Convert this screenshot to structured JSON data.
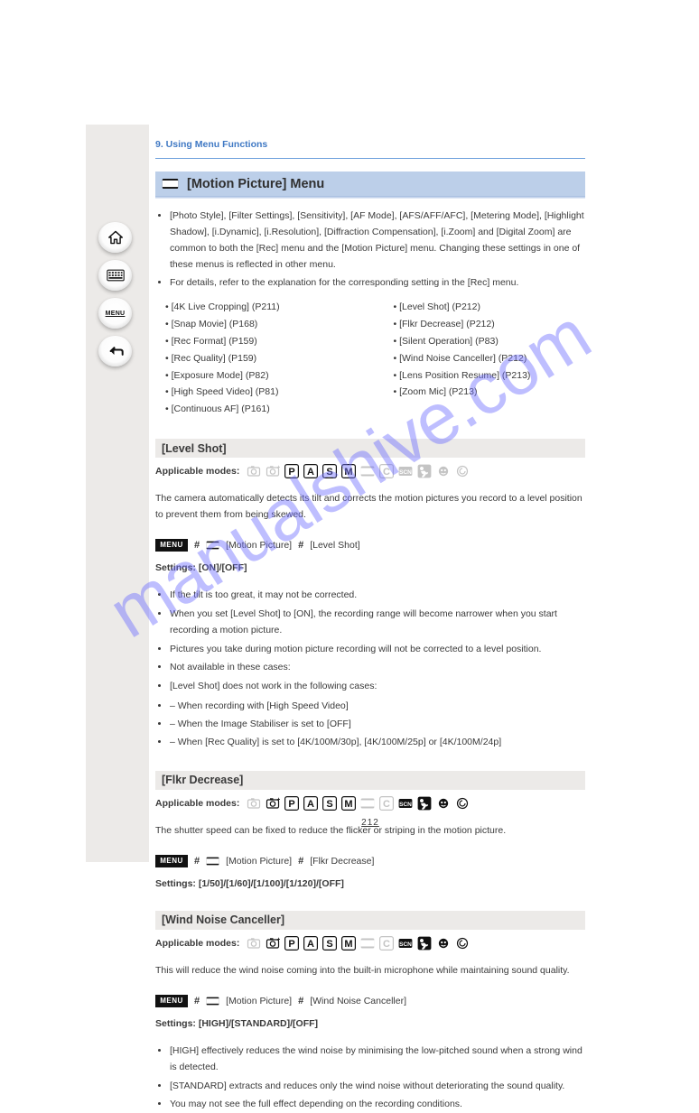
{
  "page": {
    "crumb": "9. Using Menu Functions",
    "title": "[Motion Picture] Menu",
    "page_number": "212"
  },
  "nav": {
    "menu_label": "MENU"
  },
  "intro": {
    "paragraphs": [
      "[Photo Style], [Filter Settings], [Sensitivity], [AF Mode], [AFS/AFF/AFC], [Metering Mode], [Highlight Shadow], [i.Dynamic], [i.Resolution], [Diffraction Compensation], [i.Zoom] and [Digital Zoom] are common to both the [Rec] menu and the [Motion Picture] menu. Changing these settings in one of these menus is reflected in other menu.",
      "For details, refer to the explanation for the corresponding setting in the [Rec] menu."
    ],
    "links": [
      "[4K Live Cropping] (P211)",
      "[Snap Movie] (P168)",
      "[Rec Format] (P159)",
      "[Rec Quality] (P159)",
      "[Exposure Mode] (P82)",
      "[High Speed Video] (P81)",
      "[Continuous AF] (P161)",
      "[Level Shot] (P212)",
      "[Flkr Decrease] (P212)",
      "[Silent Operation] (P83)",
      "[Wind Noise Canceller] (P212)",
      "[Lens Position Resume] (P213)",
      "[Zoom Mic] (P213)"
    ]
  },
  "menu_chip": "MENU",
  "arrow": "#",
  "sections": [
    {
      "title": "[Level Shot]",
      "modes_label": "Applicable modes:",
      "modes": [
        "ia",
        "iaplus",
        "P",
        "A",
        "S",
        "M",
        "mov",
        "c",
        "scn",
        "run",
        "face",
        "cc"
      ],
      "modes_dim": [
        "ia",
        "iaplus",
        "mov",
        "c",
        "scn",
        "run",
        "face",
        "cc"
      ],
      "body": "The camera automatically detects its tilt and corrects the motion pictures you record to a level position to prevent them from being skewed.",
      "menu_path": [
        "[Motion Picture]",
        "[Level Shot]"
      ],
      "settings": "Settings: [ON]/[OFF]",
      "bullets": [
        "If the tilt is too great, it may not be corrected.",
        "When you set [Level Shot] to [ON], the recording range will become narrower when you start recording a motion picture.",
        "Pictures you take during motion picture recording will not be corrected to a level position.",
        "Not available in these cases:",
        "[Level Shot] does not work in the following cases:"
      ],
      "sub_bullets": [
        "When recording with [High Speed Video]",
        "When the Image Stabiliser is set to [OFF]",
        "When [Rec Quality] is set to [4K/100M/30p], [4K/100M/25p] or [4K/100M/24p]"
      ]
    },
    {
      "title": "[Flkr Decrease]",
      "modes_label": "Applicable modes:",
      "modes": [
        "ia",
        "iaplus",
        "P",
        "A",
        "S",
        "M",
        "mov",
        "c",
        "scn",
        "run",
        "face",
        "cc"
      ],
      "modes_dim": [
        "ia",
        "mov",
        "c"
      ],
      "body": "The shutter speed can be fixed to reduce the flicker or striping in the motion picture.",
      "menu_path": [
        "[Motion Picture]",
        "[Flkr Decrease]"
      ],
      "settings": "Settings: [1/50]/[1/60]/[1/100]/[1/120]/[OFF]"
    },
    {
      "title": "[Wind Noise Canceller]",
      "modes_label": "Applicable modes:",
      "modes": [
        "ia",
        "iaplus",
        "P",
        "A",
        "S",
        "M",
        "mov",
        "c",
        "scn",
        "run",
        "face",
        "cc"
      ],
      "modes_dim": [
        "ia",
        "mov",
        "c"
      ],
      "body": "This will reduce the wind noise coming into the built-in microphone while maintaining sound quality.",
      "menu_path": [
        "[Motion Picture]",
        "[Wind Noise Canceller]"
      ],
      "settings": "Settings: [HIGH]/[STANDARD]/[OFF]",
      "bullets": [
        "[HIGH] effectively reduces the wind noise by minimising the low-pitched sound when a strong wind is detected.",
        "[STANDARD] extracts and reduces only the wind noise without deteriorating the sound quality.",
        "You may not see the full effect depending on the recording conditions."
      ]
    }
  ],
  "watermark": "manualshive.com"
}
